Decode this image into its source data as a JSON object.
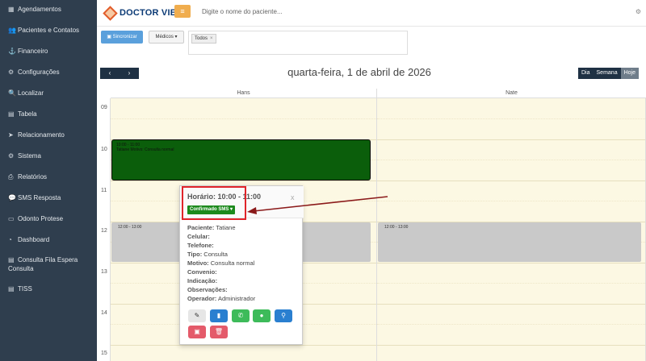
{
  "sidebar": {
    "items": [
      {
        "label": "Agendamentos",
        "icon": "calendar-icon",
        "glyph": "▦"
      },
      {
        "label": "Pacientes e Contatos",
        "icon": "users-icon",
        "glyph": "👥"
      },
      {
        "label": "Financeiro",
        "icon": "money-icon",
        "glyph": "⚓"
      },
      {
        "label": "Configurações",
        "icon": "gear-icon",
        "glyph": "⚙"
      },
      {
        "label": "Localizar",
        "icon": "search-icon",
        "glyph": "🔍"
      },
      {
        "label": "Tabela",
        "icon": "table-icon",
        "glyph": "▤"
      },
      {
        "label": "Relacionamento",
        "icon": "send-icon",
        "glyph": "➤"
      },
      {
        "label": "Sistema",
        "icon": "cogs-icon",
        "glyph": "⚙"
      },
      {
        "label": "Relatórios",
        "icon": "print-icon",
        "glyph": "⎙"
      },
      {
        "label": "SMS Resposta",
        "icon": "chat-icon",
        "glyph": "💬"
      },
      {
        "label": "Odonto Protese",
        "icon": "list-icon",
        "glyph": "▭"
      },
      {
        "label": "Dashboard",
        "icon": "dashboard-icon",
        "glyph": "◔"
      },
      {
        "label": "Consulta Fila Espera",
        "label2": "Consulta",
        "icon": "list-alt-icon",
        "glyph": "▤"
      },
      {
        "label": "TISS",
        "icon": "tiss-icon",
        "glyph": "▤"
      }
    ]
  },
  "header": {
    "logo_text": "DOCTOR VIEW",
    "menu_glyph": "≡",
    "search_placeholder": "Digite o nome do paciente...",
    "right_icon": "⚙"
  },
  "filters": {
    "sync_label": "Sincronizar",
    "medicos_label": "Médicos ▾",
    "tag_label": "Todos",
    "tag_close": "×"
  },
  "calendar": {
    "prev": "‹",
    "next": "›",
    "title": "quarta-feira, 1 de abril de 2026",
    "views": [
      "Dia",
      "Semana",
      "Hoje"
    ],
    "columns": [
      "Hans",
      "Nate"
    ],
    "hours": [
      "09",
      "10",
      "11",
      "12",
      "13",
      "14",
      "15"
    ],
    "event_green": {
      "time": "10:00 - 11:00",
      "text": "Tatiane Motivo: Consulta normal",
      "color": "#0b5e0b"
    },
    "event_gray_1": {
      "time": "12:00 - 13:00"
    },
    "event_gray_2": {
      "time": "12:00 - 13:00"
    }
  },
  "popup": {
    "time_label": "Horário: 10:00 - 11:00",
    "close": "x",
    "status": "Confirmado SMS ▾",
    "status_color": "#1c8a1c",
    "rows": [
      {
        "k": "Paciente:",
        "v": "Tatiane"
      },
      {
        "k": "Celular:",
        "v": ""
      },
      {
        "k": "Telefone:",
        "v": ""
      },
      {
        "k": "Tipo:",
        "v": "Consulta"
      },
      {
        "k": "Motivo:",
        "v": "Consulta normal"
      },
      {
        "k": "Convenio:",
        "v": ""
      },
      {
        "k": "Indicação:",
        "v": ""
      },
      {
        "k": "Observações:",
        "v": ""
      },
      {
        "k": "Operador:",
        "v": "Administrador"
      }
    ],
    "actions": [
      {
        "name": "edit-button",
        "glyph": "✎",
        "color": "#e6e6e6",
        "fg": "#333"
      },
      {
        "name": "document-button",
        "glyph": "▮",
        "color": "#2a7fd0",
        "fg": "#fff"
      },
      {
        "name": "whatsapp-button",
        "glyph": "✆",
        "color": "#3dbb5a",
        "fg": "#fff"
      },
      {
        "name": "chat-button",
        "glyph": "●",
        "color": "#3dbb5a",
        "fg": "#fff"
      },
      {
        "name": "search-button",
        "glyph": "⚲",
        "color": "#2a7fd0",
        "fg": "#fff"
      },
      {
        "name": "calendar-remove-button",
        "glyph": "▣",
        "color": "#e45a6a",
        "fg": "#fff"
      },
      {
        "name": "delete-button",
        "glyph": "🗑",
        "color": "#e45a6a",
        "fg": "#fff"
      }
    ]
  }
}
